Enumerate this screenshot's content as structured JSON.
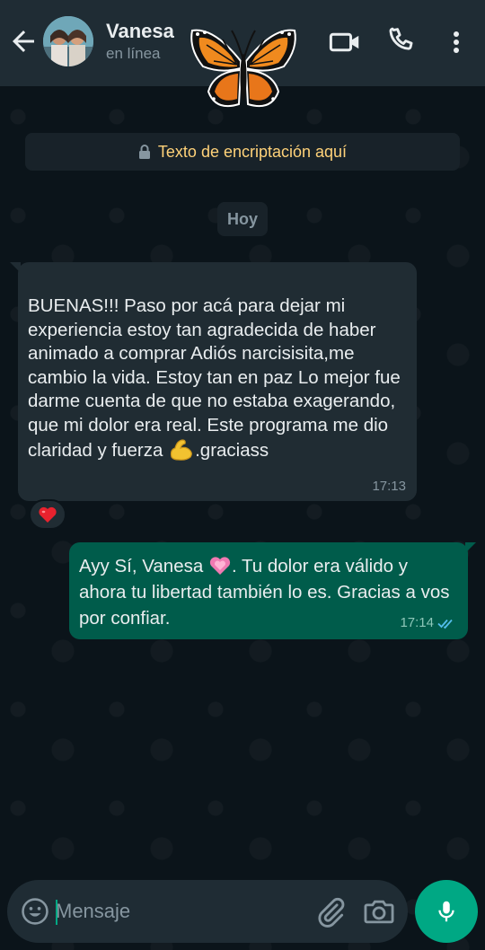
{
  "header": {
    "contact_name": "Vanesa",
    "status": "en línea",
    "icons": [
      "back-arrow-icon",
      "avatar",
      "butterfly-sticker",
      "video-call-icon",
      "phone-icon",
      "more-vert-icon"
    ]
  },
  "chat": {
    "encryption_notice": "Texto de encriptación aquí",
    "date_chip": "Hoy",
    "messages": [
      {
        "direction": "incoming",
        "text_before_emoji": " BUENAS!!! Paso por acá para dejar mi experiencia estoy tan agradecida de haber animado a comprar Adiós narcisisita,me cambio la vida. Estoy tan en paz Lo mejor fue darme cuenta de que no estaba exagerando, que mi dolor era real. Este programa me dio claridad y fuerza ",
        "emoji": "💪",
        "text_after_emoji": ".graciass",
        "time": "17:13",
        "reaction": "❤️"
      },
      {
        "direction": "outgoing",
        "text_before_emoji": "Ayy Sí, Vanesa ",
        "emoji": "💗",
        "text_after_emoji": ". Tu dolor era válido y ahora tu libertad también lo es. Gracias a vos por confiar.",
        "time": "17:14",
        "status": "read"
      }
    ]
  },
  "composer": {
    "placeholder": "Mensaje",
    "value": "",
    "icons": [
      "emoji-icon",
      "attach-icon",
      "camera-icon",
      "mic-icon"
    ]
  },
  "colors": {
    "background": "#0b141a",
    "header": "#1f2c34",
    "incoming_bubble": "#202c33",
    "outgoing_bubble": "#005c4b",
    "accent": "#00a884",
    "encryption_text": "#ffd279",
    "read_ticks": "#53bdeb"
  }
}
